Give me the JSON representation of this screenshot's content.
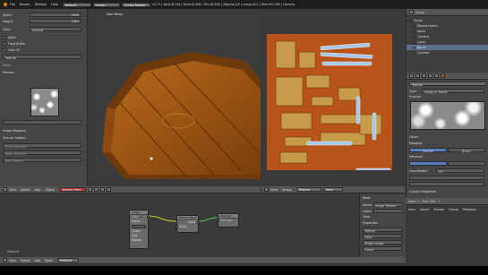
{
  "topbar": {
    "menus": [
      "File",
      "Render",
      "Window",
      "Help"
    ],
    "layout": "Default",
    "scene": "Scene",
    "engine": "Cycles Render",
    "stats": "v2.72 | Verts:8,744 | Faces:8,458 | Tris:16,916 | Objects:1/5 | Lamps:0/1 | Mem:63.24M | Camera"
  },
  "left_panel": {
    "fields": [
      {
        "label": "Width:",
        "value": "1024"
      },
      {
        "label": "Height:",
        "value": "1024"
      }
    ],
    "color_label": "Color:",
    "color_value": "Default",
    "checkboxes": [
      "Alpha",
      "Float Buffer",
      "Lock UV"
    ],
    "texture_header": "Texture",
    "image_label": "Noise",
    "preview_label": "Preview",
    "mapping_label": "Image Mapping",
    "section": "Texture Options",
    "lines": [
      "Show Textures",
      "Bake Textures",
      "Add Texture"
    ]
  },
  "viewport": {
    "header_label": "User Persp",
    "bottom_menus": [
      "View",
      "Select",
      "Add",
      "Object"
    ],
    "mode": "Texture Paint"
  },
  "uv_editor": {
    "bottom_menus": [
      "View",
      "Image"
    ],
    "image_name": "Texture",
    "mode": "Paint"
  },
  "outliner": {
    "header": "Scene",
    "items": [
      "Scene",
      "RenderLayers",
      "World",
      "Camera",
      "Lamp",
      "Barrel",
      "Cylinder"
    ]
  },
  "properties": {
    "texture_type_label": "Type:",
    "texture_type": "Image or Movie",
    "texture_name": "Texture",
    "section_preview": "Preview",
    "section_colors": "Colors",
    "section_mapping": "Mapping",
    "section_influence": "Influence",
    "tabs": [
      "Texture",
      "Brush"
    ],
    "coords_label": "Coordinates:",
    "coords_value": "UV",
    "custom_props": "Custom Properties"
  },
  "node_editor": {
    "menus": [
      "View",
      "Select",
      "Add",
      "Node"
    ],
    "mode": "Material",
    "nodes": [
      {
        "title": "Image Texture",
        "rows": [
          "Color",
          "Alpha",
          "Texture",
          "Linear",
          "Flat",
          "Repeat",
          "Vector"
        ]
      },
      {
        "title": "Diffuse BSDF",
        "rows": [
          "BSDF",
          "Color",
          "Roughness",
          "Normal"
        ]
      },
      {
        "title": "Material Output",
        "rows": [
          "Surface",
          "Volume",
          "Displacement"
        ]
      }
    ],
    "side_title": "Node",
    "side_rows": [
      "Name:",
      "Image Texture",
      "Label:",
      "Color",
      "Properties",
      "Texture",
      "Color",
      "Single Image",
      "Linear",
      "Flat"
    ],
    "status": "Material"
  },
  "statusbar": {
    "menus": [
      "View",
      "Select",
      "Marker",
      "Frame",
      "Playback"
    ],
    "start": "Start: 1",
    "end": "End: 250",
    "frame": "1"
  }
}
